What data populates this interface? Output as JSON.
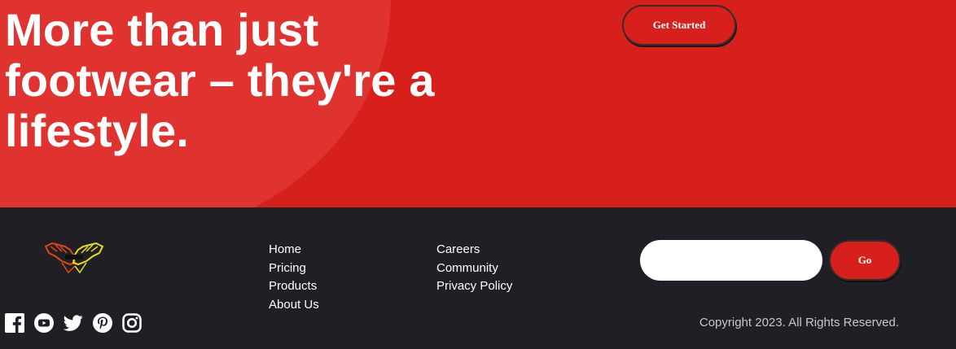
{
  "hero": {
    "title": "More than just footwear – they're a lifestyle.",
    "cta_label": "Get Started",
    "background_color": "#d71f1b",
    "blob_color": "#e0332f"
  },
  "footer": {
    "background_color": "#1f1f25",
    "logo_icon": "sneakers-logo-icon",
    "nav_col_1": [
      "Home",
      "Pricing",
      "Products",
      "About Us"
    ],
    "nav_col_2": [
      "Careers",
      "Community",
      "Privacy Policy"
    ],
    "newsletter": {
      "value": "",
      "button_label": "Go"
    },
    "social_icons": [
      "facebook-icon",
      "youtube-icon",
      "twitter-icon",
      "pinterest-icon",
      "instagram-icon"
    ],
    "copyright": "Copyright 2023. All Rights Reserved."
  }
}
